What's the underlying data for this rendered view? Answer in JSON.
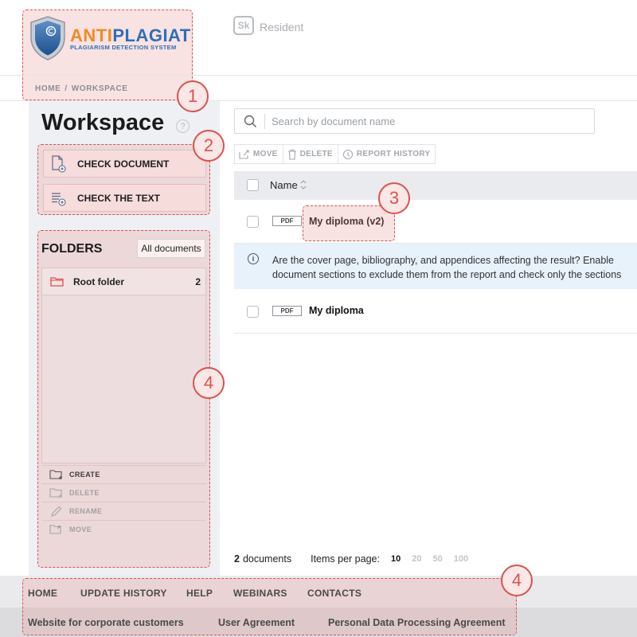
{
  "header": {
    "brand": {
      "anti": "ANTI",
      "plagiat": "PLAGIAT",
      "subtitle": "PLAGIARISM DETECTION SYSTEM"
    },
    "partner": {
      "mark": "Sk",
      "name": "Resident"
    }
  },
  "breadcrumb": [
    "HOME",
    "WORKSPACE"
  ],
  "breadcrumb_sep": "/",
  "sidebar": {
    "title": "Workspace",
    "help": "?",
    "check_document": "CHECK DOCUMENT",
    "check_text": "CHECK THE TEXT",
    "folders_title": "FOLDERS",
    "all_documents": "All documents",
    "folders": [
      {
        "name": "Root folder",
        "count": "2"
      }
    ],
    "folder_actions": [
      {
        "label": "CREATE",
        "enabled": true
      },
      {
        "label": "DELETE",
        "enabled": false
      },
      {
        "label": "RENAME",
        "enabled": false
      },
      {
        "label": "MOVE",
        "enabled": false
      }
    ]
  },
  "main": {
    "search_placeholder": "Search by document name",
    "toolbar": {
      "move": "MOVE",
      "delete": "DELETE",
      "report_history": "REPORT HISTORY"
    },
    "table_header": "Name",
    "documents": [
      {
        "type": "PDF",
        "name": "My diploma (v2)"
      },
      {
        "type": "PDF",
        "name": "My diploma"
      }
    ],
    "info_message": "Are the cover page, bibliography, and appendices affecting the result? Enable document sections to exclude them from the report and check only the sections you need.",
    "pager": {
      "count": "2",
      "count_label": "documents",
      "items_per_page": "Items per page:",
      "options": [
        "10",
        "20",
        "50",
        "100"
      ],
      "selected": "10"
    }
  },
  "footer": {
    "nav": [
      "HOME",
      "UPDATE HISTORY",
      "HELP",
      "WEBINARS",
      "CONTACTS"
    ],
    "links": [
      "Website for corporate customers",
      "User Agreement",
      "Personal Data Processing Agreement"
    ]
  },
  "annotations": [
    "1",
    "2",
    "3",
    "4",
    "4"
  ],
  "colors": {
    "highlight": "#d9534f",
    "brand_orange": "#f08a24",
    "brand_blue": "#2d6fb8",
    "info_bg": "#e8f2fb",
    "folder_icon": "#e74c4c"
  }
}
